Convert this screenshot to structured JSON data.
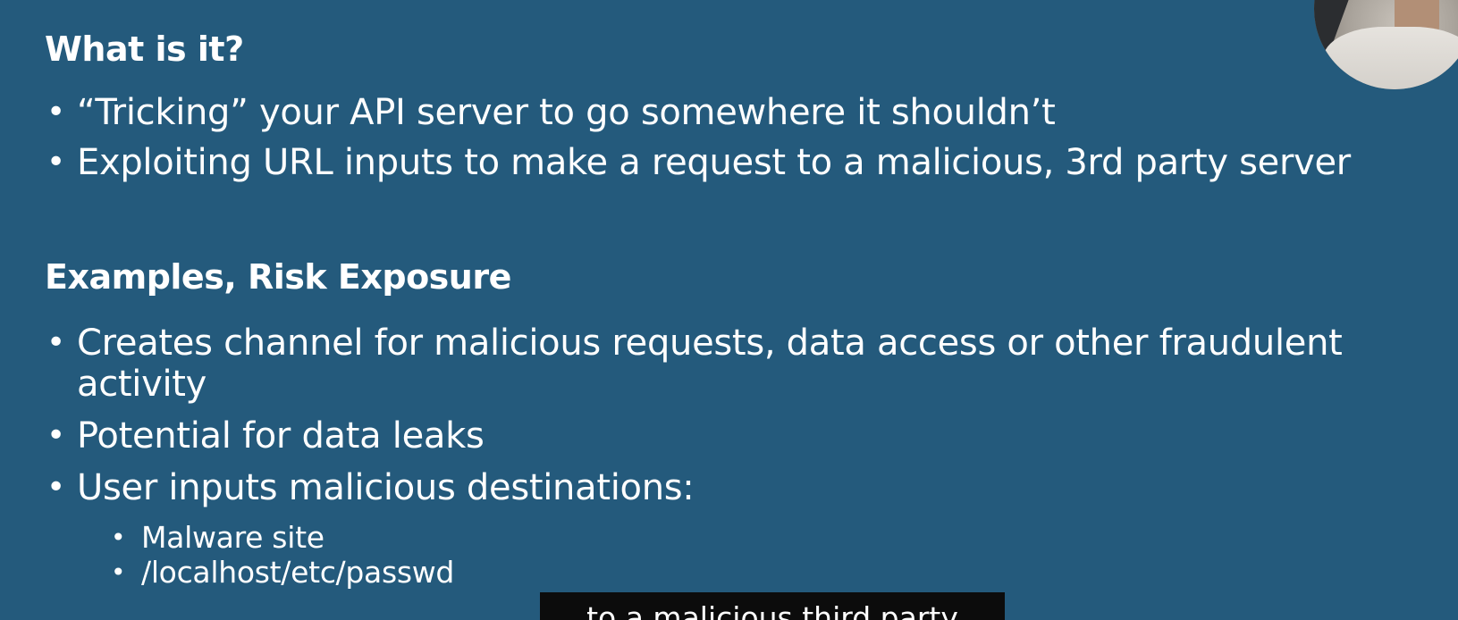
{
  "slide": {
    "section_1": {
      "heading": "What is it?",
      "bullets": [
        "“Tricking” your API server to go somewhere it shouldn’t",
        "Exploiting URL inputs to make a request to a malicious, 3rd party server"
      ]
    },
    "section_2": {
      "heading": "Examples, Risk Exposure",
      "bullets": [
        "Creates channel for malicious requests, data access or other fraudulent activity",
        "Potential for data leaks",
        "User inputs malicious destinations:"
      ],
      "sub_bullets": [
        "Malware site",
        "/localhost/etc/passwd"
      ]
    }
  },
  "caption": {
    "text": "to a malicious third party"
  },
  "colors": {
    "slide_background": "#245a7c",
    "text": "#ffffff",
    "caption_background": "#0c0c0c"
  }
}
